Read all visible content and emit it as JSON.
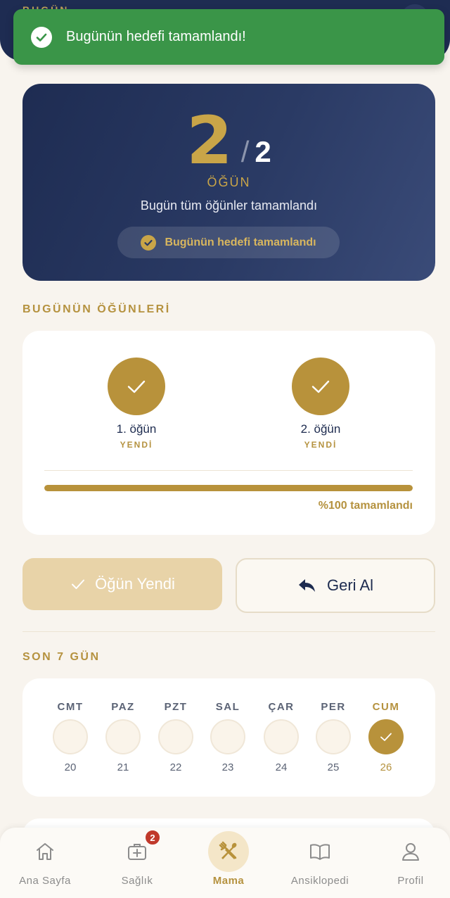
{
  "header": {
    "partial_title": "BUGÜN"
  },
  "toast": {
    "message": "Bugünün hedefi tamamlandı!",
    "color": "#3a9548"
  },
  "summary": {
    "completed": "2",
    "separator": "/",
    "total": "2",
    "unit": "ÖĞÜN",
    "subtitle": "Bugün tüm öğünler tamamlandı",
    "goal_badge": "Bugünün hedefi tamamlandı"
  },
  "meals_section": {
    "title": "BUGÜNÜN ÖĞÜNLERİ",
    "meals": [
      {
        "name": "1. öğün",
        "status": "YENDİ",
        "done": true
      },
      {
        "name": "2. öğün",
        "status": "YENDİ",
        "done": true
      }
    ],
    "progress_percent": 100,
    "progress_label": "%100 tamamlandı"
  },
  "actions": {
    "eaten_label": "Öğün Yendi",
    "undo_label": "Geri Al"
  },
  "week_section": {
    "title": "SON 7 GÜN",
    "days": [
      {
        "label": "CMT",
        "num": "20",
        "done": false
      },
      {
        "label": "PAZ",
        "num": "21",
        "done": false
      },
      {
        "label": "PZT",
        "num": "22",
        "done": false
      },
      {
        "label": "SAL",
        "num": "23",
        "done": false
      },
      {
        "label": "ÇAR",
        "num": "24",
        "done": false
      },
      {
        "label": "PER",
        "num": "25",
        "done": false
      },
      {
        "label": "CUM",
        "num": "26",
        "done": true
      }
    ]
  },
  "nav": {
    "items": [
      {
        "label": "Ana Sayfa",
        "icon": "home-icon"
      },
      {
        "label": "Sağlık",
        "icon": "medical-kit-icon",
        "badge": "2"
      },
      {
        "label": "Mama",
        "icon": "fork-knife-icon",
        "active": true
      },
      {
        "label": "Ansiklopedi",
        "icon": "book-icon"
      },
      {
        "label": "Profil",
        "icon": "user-icon"
      }
    ]
  },
  "colors": {
    "navy": "#1e2c52",
    "gold": "#b8923b",
    "background": "#f8f4ee",
    "success": "#3a9548",
    "badge": "#c0392b"
  }
}
